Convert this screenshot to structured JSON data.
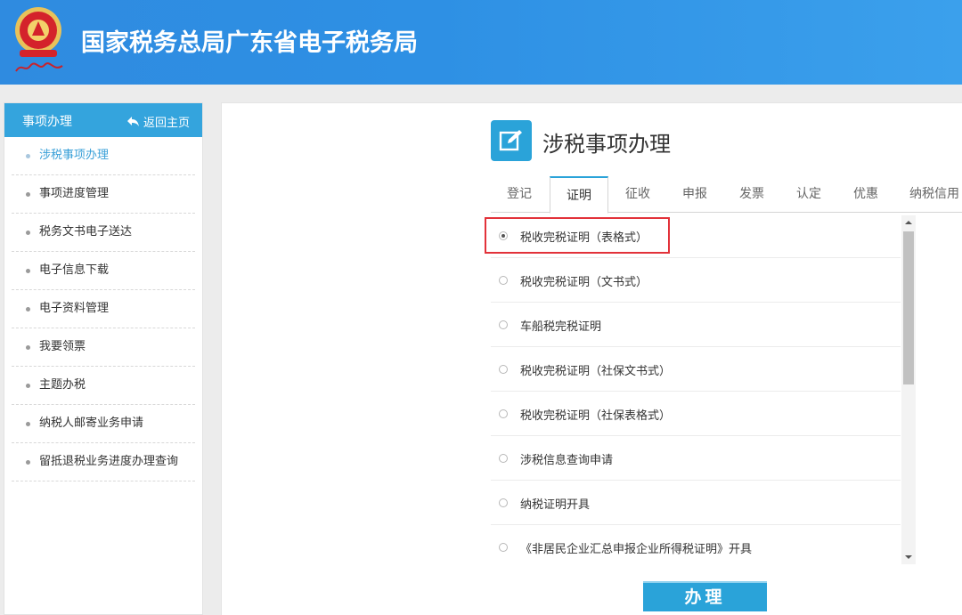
{
  "header": {
    "site_title": "国家税务总局广东省电子税务局",
    "emblem_icon": "tax-emblem-icon"
  },
  "sidebar": {
    "title": "事项办理",
    "home_label": "返回主页",
    "home_icon": "back-arrow-icon",
    "items": [
      {
        "label": "涉税事项办理",
        "active": true
      },
      {
        "label": "事项进度管理"
      },
      {
        "label": "税务文书电子送达"
      },
      {
        "label": "电子信息下载"
      },
      {
        "label": "电子资料管理"
      },
      {
        "label": "我要领票"
      },
      {
        "label": "主题办税"
      },
      {
        "label": "纳税人邮寄业务申请"
      },
      {
        "label": "留抵退税业务进度办理查询"
      }
    ]
  },
  "main": {
    "title": "涉税事项办理",
    "title_icon": "edit-icon",
    "tabs": [
      {
        "label": "登记"
      },
      {
        "label": "证明",
        "active": true
      },
      {
        "label": "征收"
      },
      {
        "label": "申报"
      },
      {
        "label": "发票"
      },
      {
        "label": "认定"
      },
      {
        "label": "优惠"
      },
      {
        "label": "纳税信用"
      }
    ],
    "options": [
      {
        "label": "税收完税证明（表格式）",
        "selected": true
      },
      {
        "label": "税收完税证明（文书式）"
      },
      {
        "label": "车船税完税证明"
      },
      {
        "label": "税收完税证明（社保文书式）"
      },
      {
        "label": "税收完税证明（社保表格式）"
      },
      {
        "label": "涉税信息查询申请"
      },
      {
        "label": "纳税证明开具"
      },
      {
        "label": "《非居民企业汇总申报企业所得税证明》开具"
      }
    ],
    "submit_label": "办理"
  },
  "colors": {
    "header_blue": "#2f8be0",
    "accent": "#2aa3d9",
    "highlight_red": "#e2323a"
  }
}
